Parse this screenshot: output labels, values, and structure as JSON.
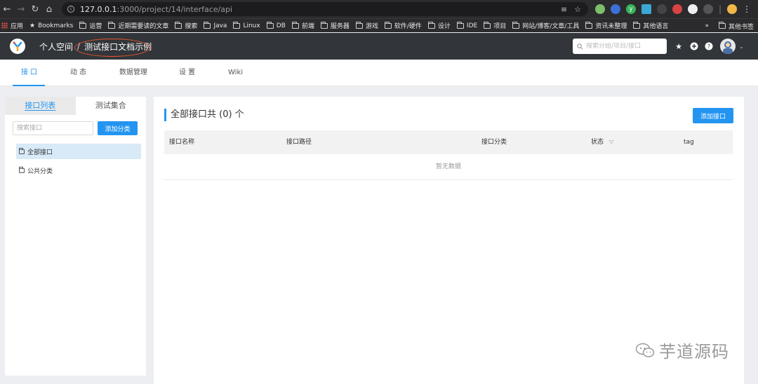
{
  "browser": {
    "url_host": "127.0.0.1",
    "url_rest": ":3000/project/14/interface/api",
    "bookmarks": [
      "应用",
      "Bookmarks",
      "运营",
      "近期需要读的文章",
      "搜索",
      "Java",
      "Linux",
      "DB",
      "前端",
      "服务器",
      "游戏",
      "软件/硬件",
      "设计",
      "IDE",
      "项目",
      "网站/博客/文章/工具",
      "资讯未整理",
      "其他语言"
    ],
    "overflow": "»",
    "other_bookmarks": "其他书签"
  },
  "header": {
    "crumb_personal": "个人空间",
    "crumb_sep": "/",
    "crumb_project": "测试接口文档示例",
    "search_placeholder": "搜索分组/项目/接口"
  },
  "tabs": [
    "接 口",
    "动 态",
    "数据管理",
    "设 置",
    "Wiki"
  ],
  "left": {
    "tab_list": "接口列表",
    "tab_collection": "测试集合",
    "search_placeholder": "搜索接口",
    "add_category": "添加分类",
    "items": [
      "全部接口",
      "公共分类"
    ]
  },
  "main": {
    "title": "全部接口共 (0) 个",
    "add_api": "添加接口",
    "columns": [
      "接口名称",
      "接口路径",
      "接口分类",
      "状态",
      "tag"
    ],
    "empty": "暂无数据"
  },
  "watermark": "芋道源码",
  "colors": {
    "accent": "#2395f1",
    "header_bg": "#32363a",
    "mark": "#e8532c"
  }
}
